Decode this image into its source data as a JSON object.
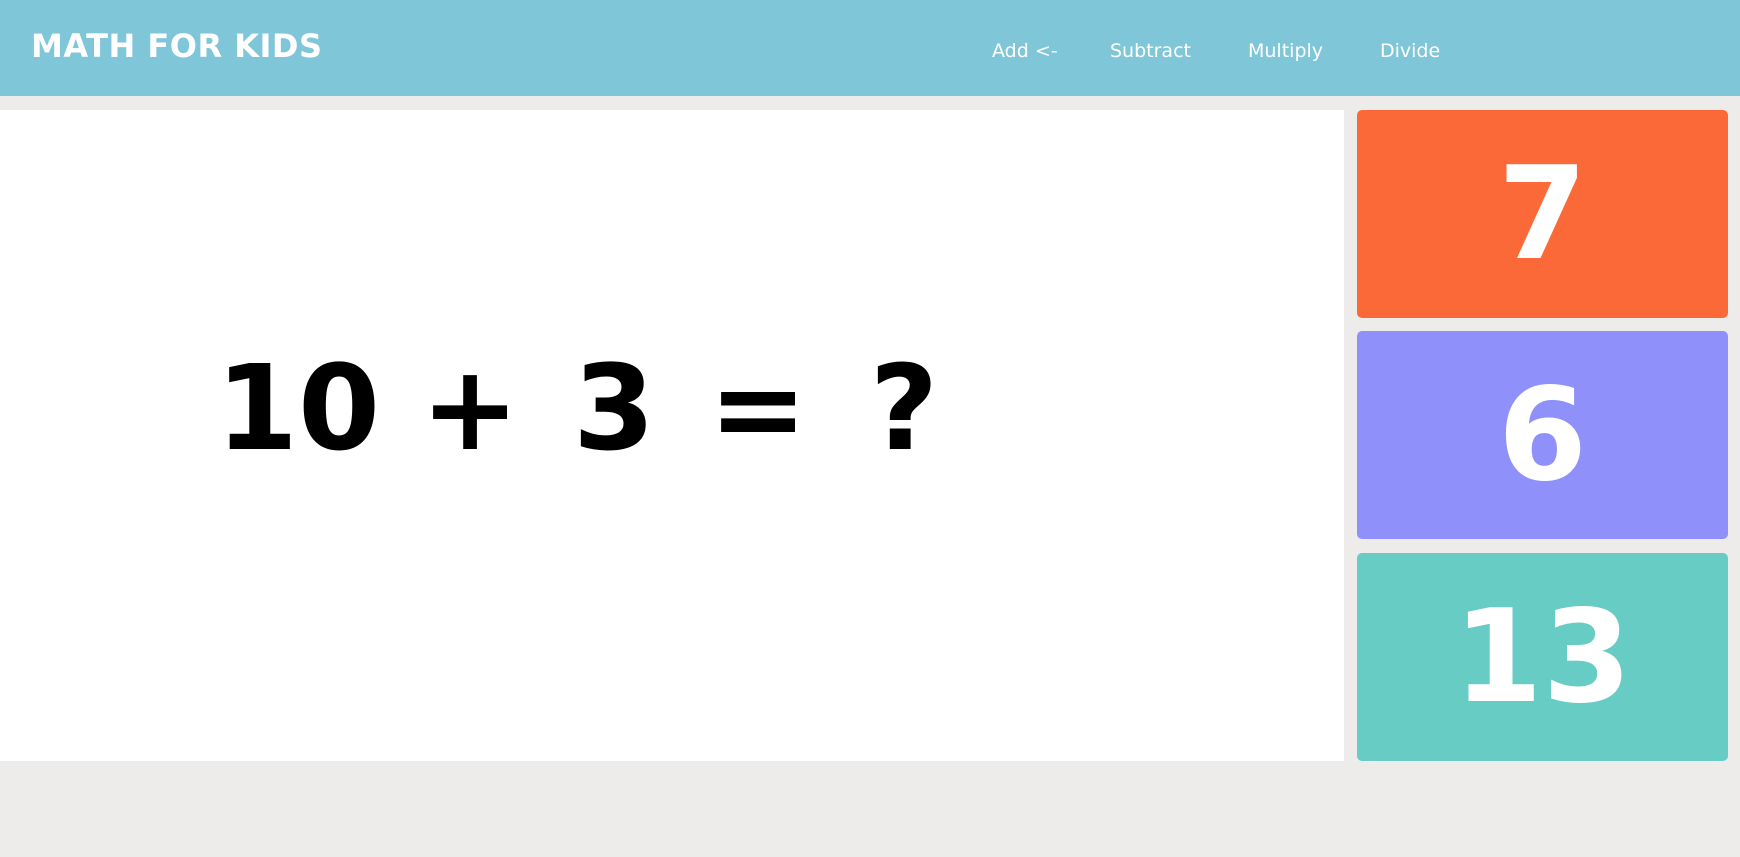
{
  "header": {
    "title": "MATH FOR KIDS",
    "background_color": "#80c6d9"
  },
  "nav": {
    "items": [
      {
        "label": "Add <-",
        "active": true
      },
      {
        "label": "Subtract",
        "active": false
      },
      {
        "label": "Multiply",
        "active": false
      },
      {
        "label": "Divide",
        "active": false
      }
    ]
  },
  "question": {
    "operand1": "10",
    "operator": "+",
    "operand2": "3",
    "equals": "=",
    "unknown": "?"
  },
  "answers": [
    {
      "value": "7",
      "color": "#fc6938"
    },
    {
      "value": "6",
      "color": "#8f90f9"
    },
    {
      "value": "13",
      "color": "#66ccc4"
    }
  ]
}
